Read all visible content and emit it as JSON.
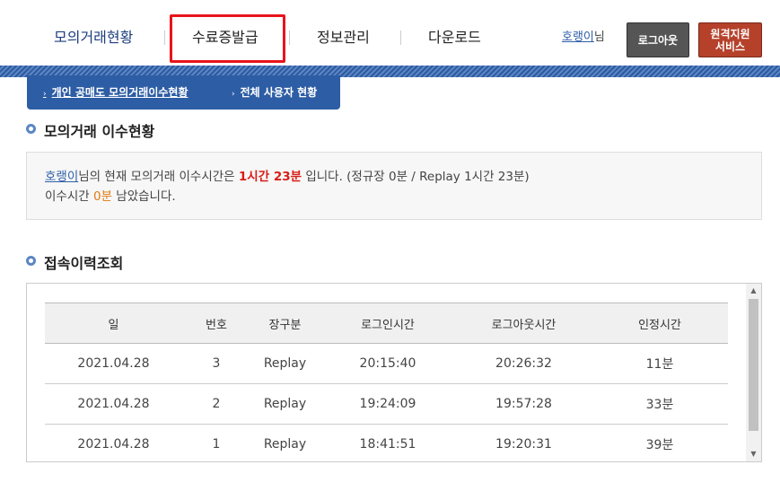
{
  "nav": {
    "items": [
      "모의거래현황",
      "수료증발급",
      "정보관리",
      "다운로드"
    ],
    "user_name": "호랭이",
    "user_suffix": "님",
    "logout": "로그아웃",
    "remote": "원격지원\n서비스"
  },
  "subtabs": [
    "개인 공매도 모의거래이수현황",
    "전체 사용자 현황"
  ],
  "status": {
    "title": "모의거래 이수현황",
    "user_name": "호랭이",
    "line1_a": "님의 현재 모의거래 이수시간은 ",
    "time_total": "1시간 23분",
    "line1_b": " 입니다. (정규장 0분 / Replay 1시간 23분)",
    "line2_a": "이수시간 ",
    "remaining": "0분",
    "line2_b": " 남았습니다."
  },
  "history": {
    "title": "접속이력조회",
    "columns": [
      "일",
      "번호",
      "장구분",
      "로그인시간",
      "로그아웃시간",
      "인정시간"
    ],
    "rows": [
      [
        "2021.04.28",
        "3",
        "Replay",
        "20:15:40",
        "20:26:32",
        "11분"
      ],
      [
        "2021.04.28",
        "2",
        "Replay",
        "19:24:09",
        "19:57:28",
        "33분"
      ],
      [
        "2021.04.28",
        "1",
        "Replay",
        "18:41:51",
        "19:20:31",
        "39분"
      ]
    ]
  },
  "colors": {
    "accent": "#2d5da4",
    "highlight": "#e8141b",
    "remote_btn": "#b5412a"
  }
}
